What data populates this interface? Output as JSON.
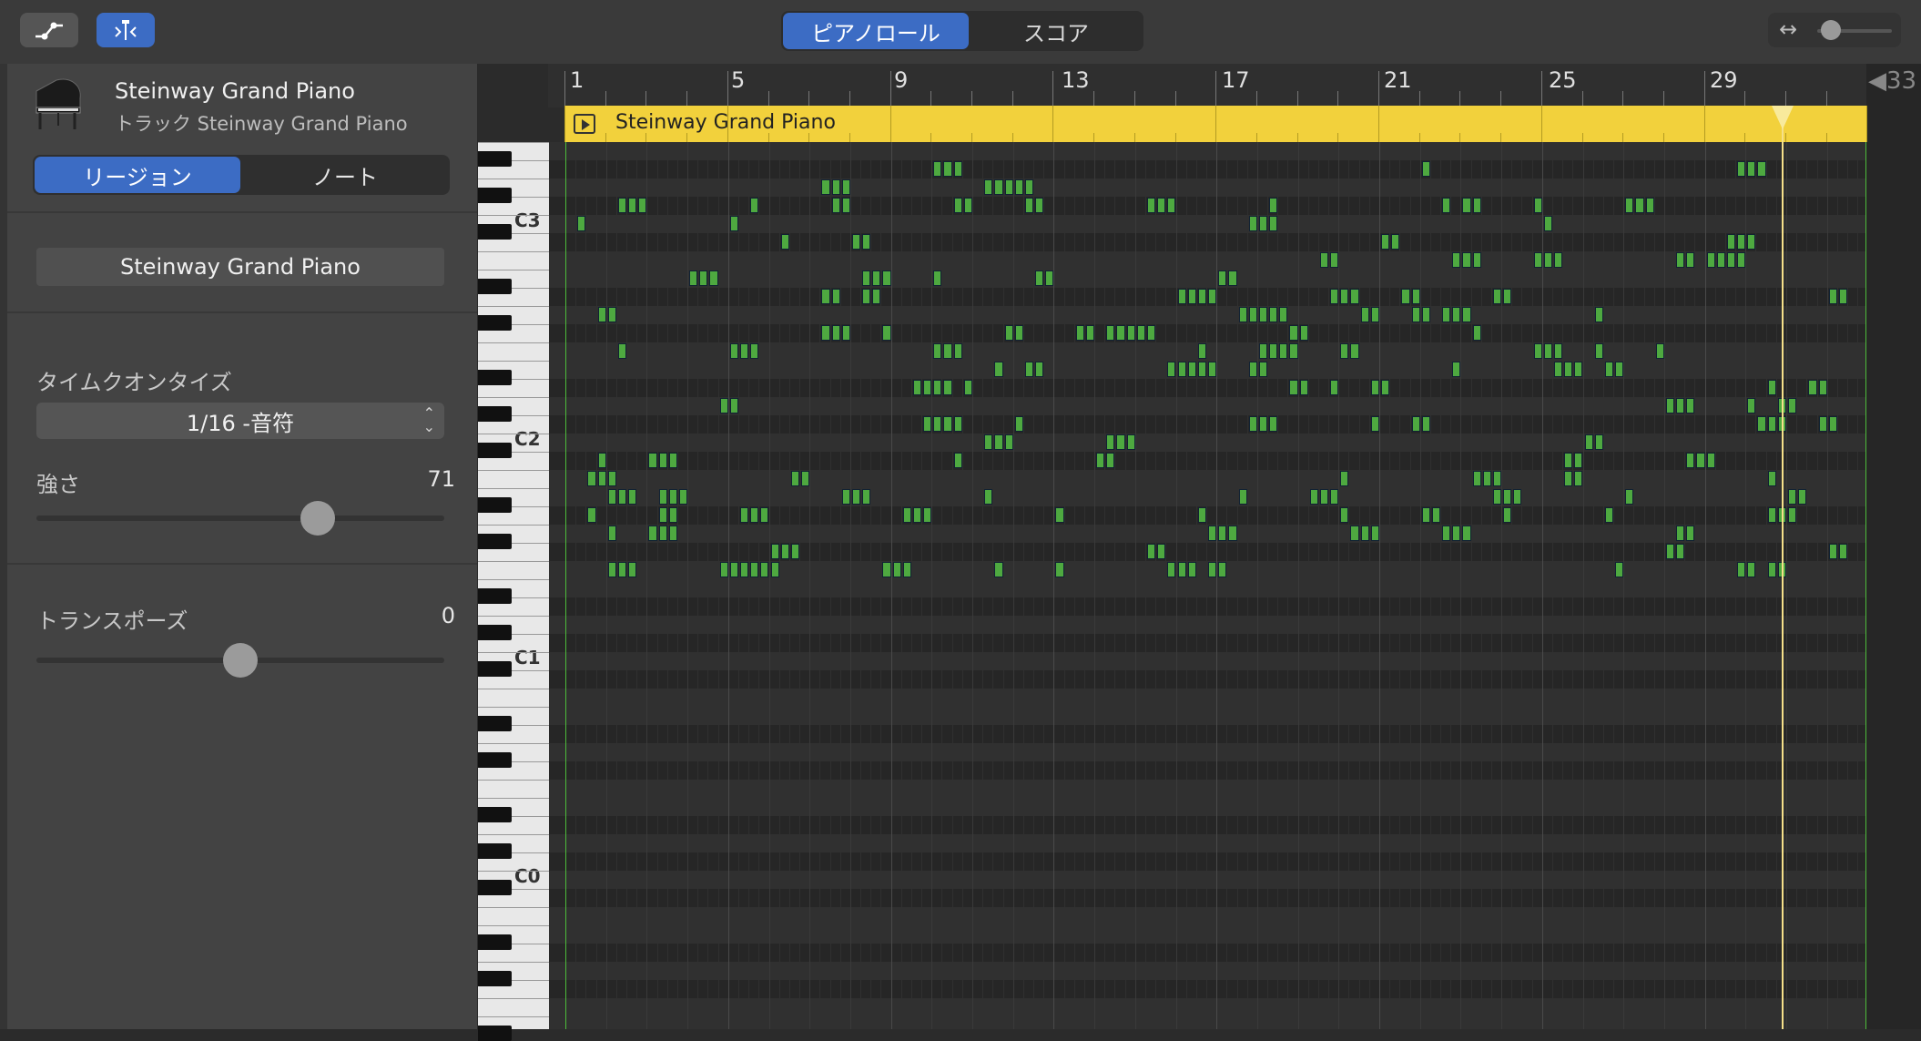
{
  "toolbar": {
    "left_buttons": [
      {
        "icon": "automation-icon"
      },
      {
        "icon": "quantize-smart-icon"
      }
    ],
    "view_segments": [
      "ピアノロール",
      "スコア"
    ],
    "selected_view": "ピアノロール",
    "zoom_icon": "horizontal-zoom-icon",
    "zoom_glyph": "↔"
  },
  "inspector": {
    "track_name": "Steinway Grand Piano",
    "track_subtitle": "トラック Steinway Grand Piano",
    "mode_segments": [
      "リージョン",
      "ノート"
    ],
    "selected_mode": "リージョン",
    "region_name": "Steinway Grand Piano",
    "quantize_label": "タイムクオンタイズ",
    "quantize_value": "1/16 -音符",
    "velocity_label": "強さ",
    "velocity_value": "71",
    "velocity_fraction": 0.69,
    "transpose_label": "トランスポーズ",
    "transpose_value": "0",
    "transpose_fraction": 0.5
  },
  "ruler": {
    "bar_numbers": [
      "1",
      "5",
      "9",
      "13",
      "17",
      "21",
      "25",
      "29"
    ],
    "end_marker": "33"
  },
  "region": {
    "name": "Steinway Grand Piano"
  },
  "keyboard": {
    "octave_labels": [
      "C3",
      "C2",
      "C1",
      "C0"
    ]
  },
  "colors": {
    "accent": "#3c6cc4",
    "region": "#f2d13c",
    "note": "#4ea940",
    "playhead": "#f5e08a"
  }
}
